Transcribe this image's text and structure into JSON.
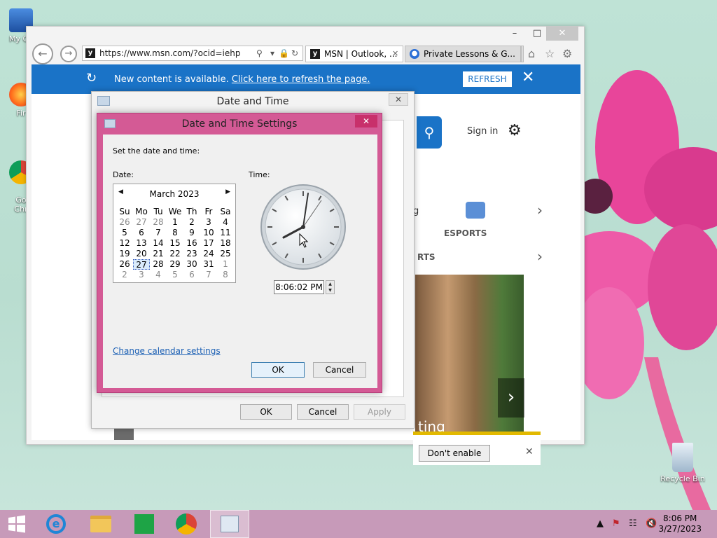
{
  "desktop": {
    "icons": [
      {
        "label": "My Co"
      },
      {
        "label": "Fir"
      },
      {
        "label": "Go\nChr"
      },
      {
        "label": "Recycle Bin"
      }
    ]
  },
  "browser": {
    "url": "https://www.msn.com/?ocid=iehp",
    "tabs": [
      {
        "label": "MSN | Outlook, ..."
      },
      {
        "label": "Private Lessons & G..."
      }
    ],
    "notification": {
      "text": "New content is available. ",
      "link": "Click here to refresh the page.",
      "button": "REFRESH"
    },
    "page": {
      "sign_in": "Sign in",
      "esports": "ESPORTS",
      "rts_fragment": "RTS",
      "g_fragment": "g",
      "addon_button": "Don't enable",
      "overlay_fragment": "ting"
    }
  },
  "date_time_dialog": {
    "title": "Date and Time",
    "ok": "OK",
    "cancel": "Cancel",
    "apply": "Apply"
  },
  "settings_dialog": {
    "title": "Date and Time Settings",
    "instruction": "Set the date and time:",
    "date_label": "Date:",
    "time_label": "Time:",
    "calendar": {
      "month": "March 2023",
      "weekdays": [
        "Su",
        "Mo",
        "Tu",
        "We",
        "Th",
        "Fr",
        "Sa"
      ],
      "weeks": [
        [
          "26",
          "27",
          "28",
          "1",
          "2",
          "3",
          "4"
        ],
        [
          "5",
          "6",
          "7",
          "8",
          "9",
          "10",
          "11"
        ],
        [
          "12",
          "13",
          "14",
          "15",
          "16",
          "17",
          "18"
        ],
        [
          "19",
          "20",
          "21",
          "22",
          "23",
          "24",
          "25"
        ],
        [
          "26",
          "27",
          "28",
          "29",
          "30",
          "31",
          "1"
        ],
        [
          "2",
          "3",
          "4",
          "5",
          "6",
          "7",
          "8"
        ]
      ],
      "selected": "27"
    },
    "time_value": "8:06:02 PM",
    "change_calendar_link": "Change calendar settings",
    "ok": "OK",
    "cancel": "Cancel"
  },
  "taskbar": {
    "time": "8:06 PM",
    "date": "3/27/2023"
  },
  "colors": {
    "accent_blue": "#1a73c7",
    "dialog_border_pink": "#d45a95",
    "taskbar": "#c79ab9"
  }
}
